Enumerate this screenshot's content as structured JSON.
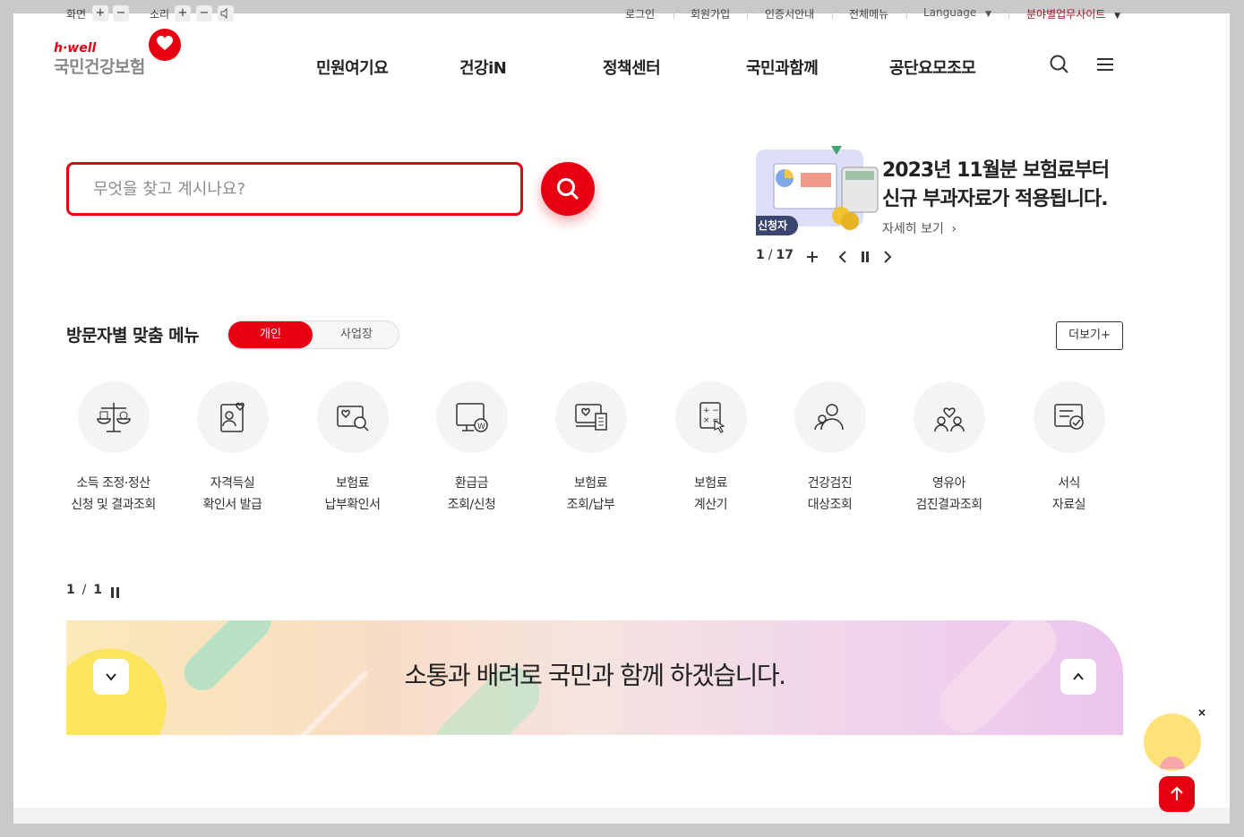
{
  "utility": {
    "screen_label": "화면",
    "sound_label": "소리",
    "plus": "+",
    "minus": "−",
    "links": [
      "로그인",
      "회원가입",
      "인증서안내",
      "전체메뉴",
      "Language",
      "분야별업무사이트"
    ]
  },
  "logo": {
    "brand_en": "h·well",
    "brand_kr": "국민건강보험"
  },
  "gnb": [
    "민원여기요",
    "건강iN",
    "정책센터",
    "국민과함께",
    "공단요모조모"
  ],
  "search": {
    "placeholder": "무엇을 찾고 계시나요?"
  },
  "banner": {
    "tag": "신청자",
    "title_line1": "2023년 11월분 보험료부터",
    "title_line2": "신규 부과자료가 적용됩니다.",
    "more": "자세히 보기",
    "current": "1",
    "total": "17"
  },
  "section": {
    "title": "방문자별 맞춤 메뉴",
    "tab_personal": "개인",
    "tab_business": "사업장",
    "more": "더보기+"
  },
  "menu": [
    {
      "line1": "소득 조정·정산",
      "line2": "신청 및 결과조회",
      "icon": "scale-icon"
    },
    {
      "line1": "자격득실",
      "line2": "확인서 발급",
      "icon": "id-card-icon"
    },
    {
      "line1": "보험료",
      "line2": "납부확인서",
      "icon": "payment-search-icon"
    },
    {
      "line1": "환급금",
      "line2": "조회/신청",
      "icon": "refund-monitor-icon"
    },
    {
      "line1": "보험료",
      "line2": "조회/납부",
      "icon": "bill-monitor-icon"
    },
    {
      "line1": "보험료",
      "line2": "계산기",
      "icon": "calculator-icon"
    },
    {
      "line1": "건강검진",
      "line2": "대상조회",
      "icon": "checkup-person-icon"
    },
    {
      "line1": "영유아",
      "line2": "검진결과조회",
      "icon": "family-icon"
    },
    {
      "line1": "서식",
      "line2": "자료실",
      "icon": "form-check-icon"
    }
  ],
  "menu_pager": {
    "current": "1",
    "total": "1"
  },
  "slogan": {
    "text": "소통과 배려로 국민과 함께 하겠습니다."
  },
  "float": {
    "close": "×"
  },
  "colors": {
    "brand_red": "#e60012"
  }
}
